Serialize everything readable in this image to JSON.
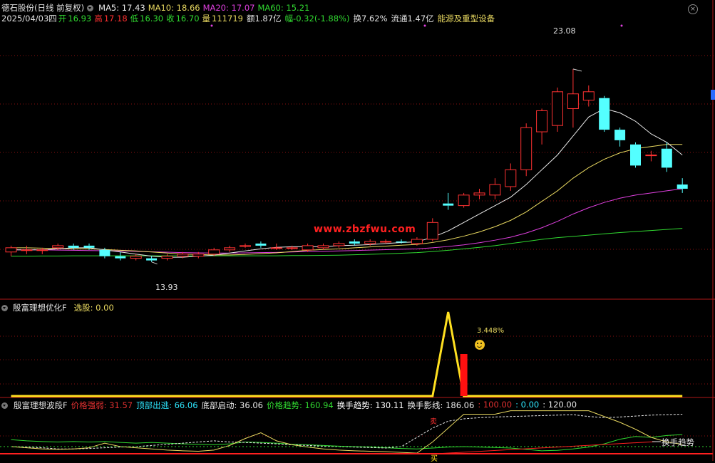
{
  "header": {
    "stock": "德石股份(日线 前复权)",
    "ma5": "MA5: 17.43",
    "ma10": "MA10: 18.66",
    "ma20": "MA20: 17.07",
    "ma60": "MA60: 15.21",
    "date": "2025/04/03四",
    "open_label": "开",
    "open": "16.93",
    "high_label": "高",
    "high": "17.18",
    "low_label": "低",
    "low": "16.30",
    "close_label": "收",
    "close": "16.70",
    "vol_label": "量",
    "vol": "111719",
    "amount": "额1.87亿",
    "change": "幅-0.32(-1.88%)",
    "turnover": "换7.62%",
    "float": "流通1.47亿",
    "sector": "能源及重型设备"
  },
  "watermark": "www.zbzfwu.com",
  "annotations": {
    "high_price": "23.08",
    "low_price": "13.93"
  },
  "panel2": {
    "title": "殷富理想优化F",
    "label": "选股: 0.00",
    "annotation": "3.448%"
  },
  "panel3": {
    "title": "殷富理想波段F",
    "items": [
      {
        "text": "价格强弱: 31.57",
        "color": "#e03030"
      },
      {
        "text": "顶部出逃: 66.06",
        "color": "#2ee8ff"
      },
      {
        "text": "底部启动: 36.06",
        "color": "#e8e8e8"
      },
      {
        "text": "价格趋势: 160.94",
        "color": "#30d830"
      },
      {
        "text": "换手趋势: 130.11",
        "color": "#ffffff"
      },
      {
        "text": "换手影线: 186.06",
        "color": "#e8e8e8"
      },
      {
        "text": ": 100.00",
        "color": "#e03030"
      },
      {
        "text": ": 0.00",
        "color": "#2ee8ff"
      },
      {
        "text": ": 120.00",
        "color": "#e8e8e8"
      }
    ],
    "right_label": "换手趋势",
    "marker_red": "卖",
    "marker_yellow": "买"
  },
  "chart_data": [
    {
      "type": "candlestick",
      "ylim": [
        12.5,
        25
      ],
      "candles": [
        {
          "o": 14.4,
          "h": 14.7,
          "l": 14.2,
          "c": 14.6
        },
        {
          "o": 14.5,
          "h": 14.7,
          "l": 14.3,
          "c": 14.5
        },
        {
          "o": 14.5,
          "h": 14.6,
          "l": 14.3,
          "c": 14.5
        },
        {
          "o": 14.6,
          "h": 14.8,
          "l": 14.5,
          "c": 14.7
        },
        {
          "o": 14.7,
          "h": 14.8,
          "l": 14.5,
          "c": 14.6
        },
        {
          "o": 14.7,
          "h": 14.8,
          "l": 14.5,
          "c": 14.6
        },
        {
          "o": 14.5,
          "h": 14.6,
          "l": 14.1,
          "c": 14.2
        },
        {
          "o": 14.2,
          "h": 14.4,
          "l": 14.0,
          "c": 14.1
        },
        {
          "o": 14.1,
          "h": 14.3,
          "l": 14.0,
          "c": 14.2
        },
        {
          "o": 14.1,
          "h": 14.2,
          "l": 13.93,
          "c": 14.0
        },
        {
          "o": 14.1,
          "h": 14.3,
          "l": 14.0,
          "c": 14.2
        },
        {
          "o": 14.2,
          "h": 14.4,
          "l": 14.1,
          "c": 14.3
        },
        {
          "o": 14.2,
          "h": 14.4,
          "l": 14.1,
          "c": 14.3
        },
        {
          "o": 14.3,
          "h": 14.6,
          "l": 14.2,
          "c": 14.5
        },
        {
          "o": 14.5,
          "h": 14.7,
          "l": 14.4,
          "c": 14.6
        },
        {
          "o": 14.7,
          "h": 14.8,
          "l": 14.6,
          "c": 14.7
        },
        {
          "o": 14.8,
          "h": 14.9,
          "l": 14.6,
          "c": 14.7
        },
        {
          "o": 14.6,
          "h": 14.8,
          "l": 14.5,
          "c": 14.6
        },
        {
          "o": 14.6,
          "h": 14.7,
          "l": 14.5,
          "c": 14.6
        },
        {
          "o": 14.5,
          "h": 14.8,
          "l": 14.4,
          "c": 14.7
        },
        {
          "o": 14.6,
          "h": 14.8,
          "l": 14.5,
          "c": 14.7
        },
        {
          "o": 14.7,
          "h": 14.9,
          "l": 14.6,
          "c": 14.8
        },
        {
          "o": 14.9,
          "h": 15.0,
          "l": 14.7,
          "c": 14.8
        },
        {
          "o": 14.8,
          "h": 15.0,
          "l": 14.7,
          "c": 14.9
        },
        {
          "o": 14.9,
          "h": 15.0,
          "l": 14.8,
          "c": 14.9
        },
        {
          "o": 14.9,
          "h": 15.0,
          "l": 14.8,
          "c": 14.85
        },
        {
          "o": 14.8,
          "h": 15.1,
          "l": 14.7,
          "c": 15.0
        },
        {
          "o": 15.0,
          "h": 16.0,
          "l": 14.9,
          "c": 15.8
        },
        {
          "o": 16.7,
          "h": 17.2,
          "l": 16.4,
          "c": 16.6
        },
        {
          "o": 16.6,
          "h": 17.2,
          "l": 16.5,
          "c": 17.1
        },
        {
          "o": 17.1,
          "h": 17.4,
          "l": 16.9,
          "c": 17.2
        },
        {
          "o": 17.1,
          "h": 17.9,
          "l": 16.9,
          "c": 17.6
        },
        {
          "o": 17.5,
          "h": 18.6,
          "l": 17.3,
          "c": 18.3
        },
        {
          "o": 18.3,
          "h": 20.5,
          "l": 18.0,
          "c": 20.3
        },
        {
          "o": 20.1,
          "h": 21.2,
          "l": 19.5,
          "c": 21.1
        },
        {
          "o": 20.4,
          "h": 22.2,
          "l": 20.1,
          "c": 22.0
        },
        {
          "o": 21.2,
          "h": 23.08,
          "l": 20.3,
          "c": 21.9
        },
        {
          "o": 21.6,
          "h": 22.3,
          "l": 21.3,
          "c": 22.0
        },
        {
          "o": 21.7,
          "h": 21.8,
          "l": 20.1,
          "c": 20.2
        },
        {
          "o": 20.2,
          "h": 20.3,
          "l": 19.4,
          "c": 19.7
        },
        {
          "o": 19.5,
          "h": 19.6,
          "l": 18.4,
          "c": 18.5
        },
        {
          "o": 19.0,
          "h": 19.2,
          "l": 18.7,
          "c": 19.0
        },
        {
          "o": 19.3,
          "h": 19.6,
          "l": 18.2,
          "c": 18.4
        },
        {
          "o": 17.6,
          "h": 17.9,
          "l": 17.2,
          "c": 17.4
        }
      ],
      "ma5": [
        14.5,
        14.5,
        14.5,
        14.55,
        14.6,
        14.6,
        14.5,
        14.4,
        14.3,
        14.2,
        14.15,
        14.15,
        14.2,
        14.25,
        14.35,
        14.45,
        14.55,
        14.62,
        14.65,
        14.65,
        14.65,
        14.7,
        14.72,
        14.75,
        14.8,
        14.85,
        14.88,
        15.1,
        15.4,
        15.8,
        16.2,
        16.6,
        17.0,
        17.6,
        18.3,
        19.0,
        19.9,
        20.8,
        21.2,
        21.0,
        20.6,
        20.0,
        19.6,
        19.0
      ],
      "ma10": [
        14.6,
        14.6,
        14.58,
        14.56,
        14.55,
        14.55,
        14.52,
        14.48,
        14.45,
        14.4,
        14.35,
        14.3,
        14.28,
        14.26,
        14.26,
        14.28,
        14.32,
        14.36,
        14.42,
        14.48,
        14.52,
        14.55,
        14.6,
        14.64,
        14.68,
        14.72,
        14.76,
        14.85,
        14.98,
        15.15,
        15.35,
        15.6,
        15.9,
        16.3,
        16.8,
        17.3,
        17.9,
        18.4,
        18.8,
        19.1,
        19.3,
        19.4,
        19.5,
        19.5
      ],
      "ma20": [
        14.5,
        14.5,
        14.5,
        14.49,
        14.48,
        14.47,
        14.46,
        14.45,
        14.43,
        14.41,
        14.39,
        14.37,
        14.36,
        14.35,
        14.35,
        14.36,
        14.37,
        14.38,
        14.4,
        14.42,
        14.43,
        14.45,
        14.47,
        14.49,
        14.51,
        14.53,
        14.55,
        14.6,
        14.66,
        14.74,
        14.84,
        14.96,
        15.1,
        15.3,
        15.55,
        15.85,
        16.2,
        16.5,
        16.75,
        16.95,
        17.1,
        17.2,
        17.3,
        17.4
      ],
      "ma60": [
        14.2,
        14.2,
        14.21,
        14.21,
        14.22,
        14.22,
        14.22,
        14.22,
        14.22,
        14.22,
        14.22,
        14.22,
        14.22,
        14.22,
        14.22,
        14.22,
        14.22,
        14.22,
        14.23,
        14.23,
        14.24,
        14.25,
        14.27,
        14.29,
        14.31,
        14.34,
        14.37,
        14.42,
        14.48,
        14.55,
        14.62,
        14.7,
        14.8,
        14.9,
        15.0,
        15.08,
        15.14,
        15.2,
        15.26,
        15.32,
        15.37,
        15.42,
        15.47,
        15.52
      ]
    },
    {
      "type": "line",
      "name": "选股",
      "values": [
        0,
        0,
        0,
        0,
        0,
        0,
        0,
        0,
        0,
        0,
        0,
        0,
        0,
        0,
        0,
        0,
        0,
        0,
        0,
        0,
        0,
        0,
        0,
        0,
        0,
        0,
        0,
        0,
        1,
        0,
        0,
        0,
        0,
        0,
        0,
        0,
        0,
        0,
        0,
        0,
        0,
        0,
        0,
        0
      ],
      "bar_index": 29,
      "bar_value": 0.5,
      "ylim": [
        0,
        1
      ]
    },
    {
      "type": "line",
      "ylim": [
        0,
        200
      ],
      "series": [
        {
          "name": "价格趋势",
          "color": "#30d830",
          "values": [
            70,
            65,
            62,
            60,
            62,
            60,
            62,
            58,
            55,
            58,
            55,
            52,
            50,
            48,
            52,
            60,
            58,
            55,
            50,
            48,
            45,
            42,
            40,
            38,
            35,
            32,
            30,
            34,
            38,
            40,
            38,
            36,
            34,
            28,
            22,
            24,
            30,
            38,
            52,
            72,
            84,
            80,
            88,
            92
          ]
        },
        {
          "name": "换手影线",
          "color": "#e8e8e8",
          "values": [
            40,
            38,
            35,
            30,
            30,
            32,
            35,
            38,
            40,
            45,
            50,
            55,
            60,
            65,
            60,
            58,
            55,
            52,
            48,
            45,
            42,
            40,
            38,
            36,
            34,
            40,
            80,
            120,
            150,
            160,
            165,
            168,
            170,
            172,
            174,
            176,
            178,
            170,
            165,
            168,
            172,
            176,
            178,
            180
          ]
        },
        {
          "name": "价格强弱",
          "color": "#e8d860",
          "values": [
            40,
            35,
            30,
            28,
            30,
            35,
            55,
            40,
            35,
            30,
            25,
            22,
            20,
            25,
            45,
            75,
            100,
            65,
            48,
            38,
            30,
            25,
            22,
            20,
            18,
            15,
            12,
            60,
            120,
            180,
            180,
            180,
            195,
            195,
            195,
            195,
            195,
            195,
            170,
            145,
            115,
            80,
            60,
            50
          ]
        }
      ]
    }
  ]
}
